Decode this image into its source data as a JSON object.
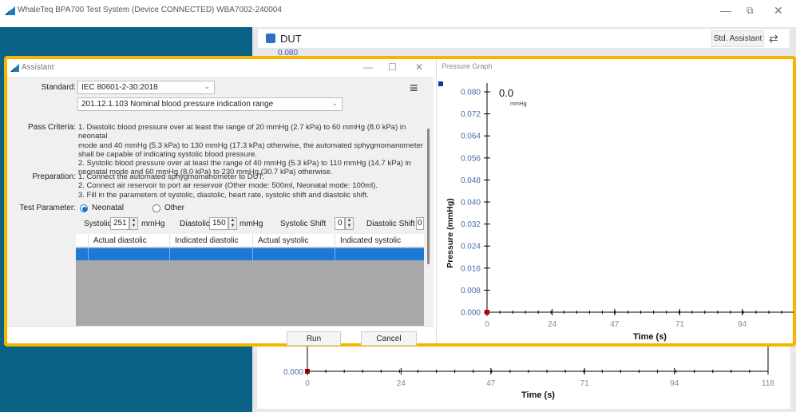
{
  "window": {
    "title": "WhaleTeq BPA700 Test System (Device CONNECTED)   WBA7002-240004",
    "minimize": "—",
    "restore": "⧉",
    "close": "✕"
  },
  "dut": {
    "label": "DUT",
    "std_assistant": "Std. Assistant",
    "swap_icon": "⇄",
    "peek_value": "0.080"
  },
  "bg_chart": {
    "y_tick": "0.000",
    "x_ticks": [
      "0",
      "24",
      "47",
      "71",
      "94",
      "118"
    ],
    "xlabel": "Time (s)"
  },
  "assistant": {
    "title": "Assistant",
    "min": "—",
    "max": "☐",
    "close": "✕",
    "standard_label": "Standard:",
    "standard_value": "IEC 80601-2-30:2018",
    "clause_value": "201.12.1.103 Nominal blood pressure indication range",
    "menu_icon": "≡",
    "pass_label": "Pass Criteria:",
    "pass_lines": [
      "1. Diastolic blood pressure over at least the range of 20 mmHg (2.7 kPa) to 60 mmHg (8.0 kPa) in neonatal",
      "mode and 40 mmHg (5.3 kPa) to 130 mmHg (17.3 kPa) otherwise, the automated sphygmomanometer",
      "shall be capable of indicating systolic blood pressure.",
      "2. Systolic blood pressure over at least the range of 40 mmHg (5.3 kPa) to 110 mmHg (14.7 kPa) in",
      "neonatal mode and 60 mmHg (8,0 kPa) to 230 mmHg (30.7 kPa) otherwise."
    ],
    "prep_label": "Preparation:",
    "prep_lines": [
      "1. Connect the automated sphygmomanometer to DUT.",
      "2. Connect air reservoir to port air reservoir (Other mode: 500ml, Neonatal mode: 100ml).",
      "3. Fill in the parameters of systolic, diastolic, heart rate, systolic shift and diastolic shift."
    ],
    "param_label": "Test Parameter:",
    "radio_neonatal": "Neonatal",
    "radio_other": "Other",
    "systolic_label": "Systolic",
    "systolic_value": "251",
    "diastolic_label": "Diastolic",
    "diastolic_value": "150",
    "unit": "mmHg",
    "sys_shift_label": "Systolic Shift",
    "sys_shift_value": "0",
    "dia_shift_label": "Diastolic Shift",
    "dia_shift_value": "0",
    "columns": [
      "Actual diastolic",
      "Indicated diastolic",
      "Actual systolic",
      "Indicated systolic"
    ],
    "run": "Run",
    "cancel": "Cancel"
  },
  "pressure_graph": {
    "title": "Pressure Graph",
    "readout": "0.0",
    "readout_unit": "mmHg"
  },
  "chart_data": {
    "type": "line",
    "title": "",
    "xlabel": "Time (s)",
    "ylabel": "Pressure (mmHg)",
    "y_ticks": [
      "0.080",
      "0.072",
      "0.064",
      "0.056",
      "0.048",
      "0.040",
      "0.032",
      "0.024",
      "0.016",
      "0.008",
      "0.000"
    ],
    "x_ticks": [
      "0",
      "24",
      "47",
      "71",
      "94"
    ],
    "xlim": [
      0,
      118
    ],
    "ylim": [
      0,
      0.08
    ],
    "series": [
      {
        "x": [
          0
        ],
        "y": [
          0.0
        ]
      }
    ],
    "colors": {
      "marker": "#c00000",
      "legend_marker": "#1a2fa8"
    }
  }
}
